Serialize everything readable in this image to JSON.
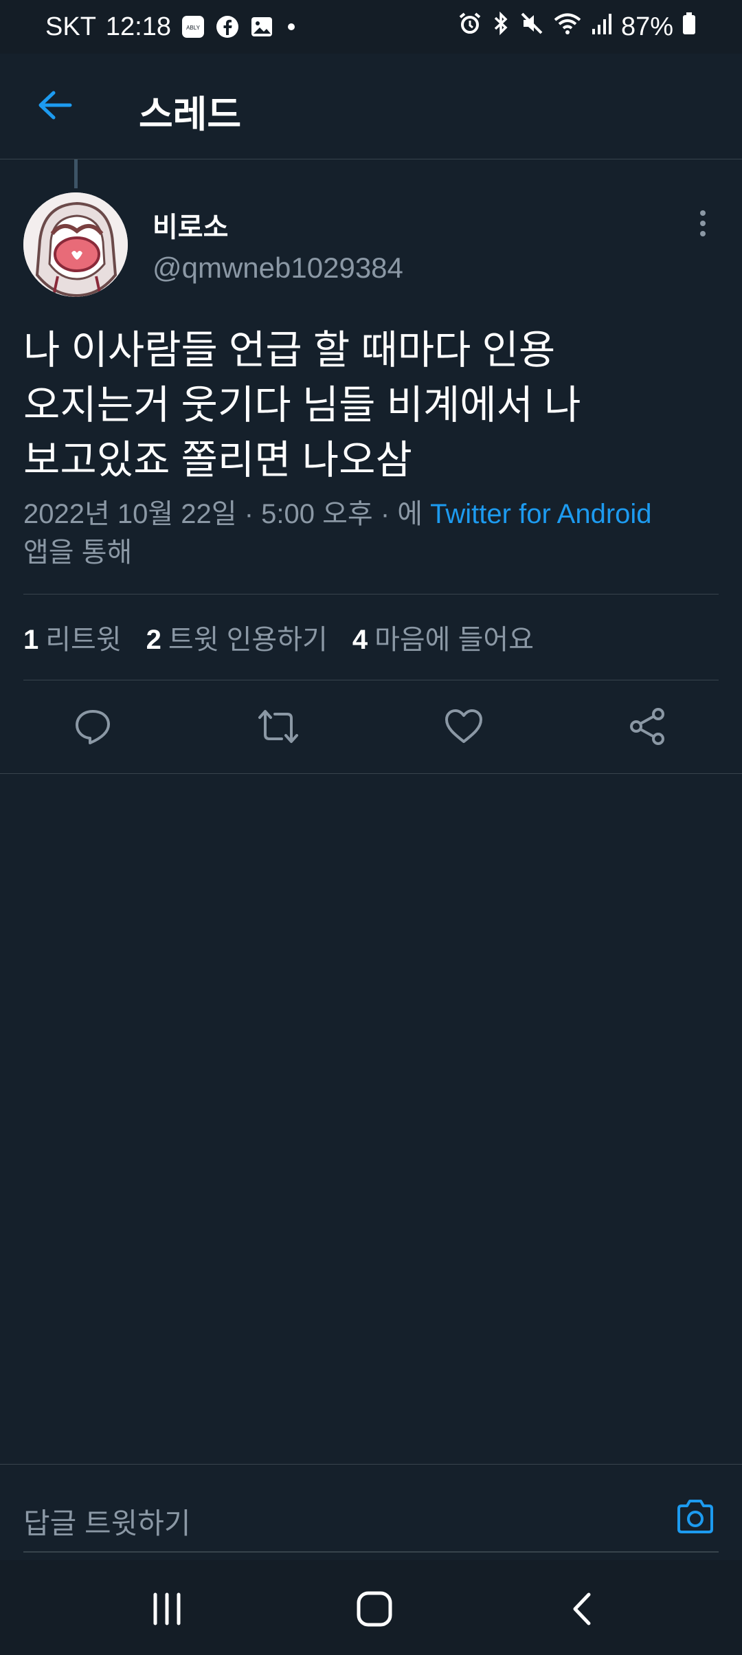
{
  "status_bar": {
    "carrier": "SKT",
    "time": "12:18",
    "notification_icons": [
      "ably-icon",
      "facebook-icon",
      "gallery-icon"
    ],
    "system_icons": [
      "alarm-icon",
      "bluetooth-icon",
      "mute-icon",
      "wifi-icon",
      "signal-icon"
    ],
    "battery": "87%"
  },
  "header": {
    "title": "스레드"
  },
  "tweet": {
    "author_name": "비로소",
    "author_handle": "@qmwneb1029384",
    "text": "나 이사람들 언급 할 때마다 인용\n오지는거 웃기다 님들 비계에서 나\n보고있죠 쫄리면 나오삼",
    "meta_prefix": "2022년 10월 22일 · 5:00 오후 · 에 ",
    "source": "Twitter for Android",
    "meta_suffix": "앱을 통해",
    "stats": {
      "retweets_count": "1",
      "retweets_label": "리트윗",
      "quotes_count": "2",
      "quotes_label": "트윗 인용하기",
      "likes_count": "4",
      "likes_label": "마음에 들어요"
    }
  },
  "reply": {
    "placeholder": "답글 트윗하기"
  },
  "colors": {
    "background": "#15202b",
    "accent": "#1d9bf0",
    "secondary_text": "#8b98a5",
    "divider": "#38444d"
  }
}
